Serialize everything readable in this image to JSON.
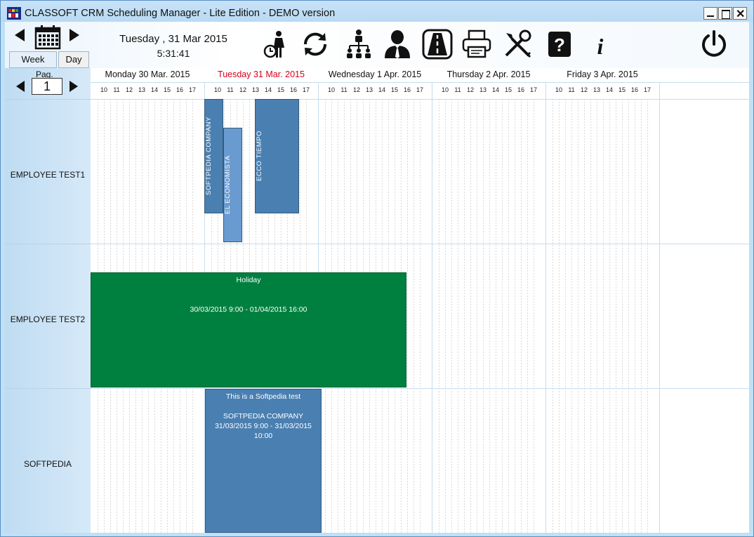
{
  "window": {
    "title": "CLASSOFT CRM Scheduling Manager  - Lite Edition  - DEMO version"
  },
  "toolbar": {
    "date": "Tuesday ,  31 Mar 2015",
    "time": "5:31:41",
    "tools": [
      "clock-person-icon",
      "refresh-icon",
      "org-chart-icon",
      "user-icon",
      "road-icon",
      "printer-icon",
      "tools-icon",
      "help-icon",
      "info-icon",
      "power-icon"
    ]
  },
  "view_tabs": {
    "week": "Week",
    "day": "Day"
  },
  "pager": {
    "label": "Pag.",
    "value": "1"
  },
  "days": [
    {
      "label": "Monday 30 Mar. 2015",
      "today": false
    },
    {
      "label": "Tuesday 31 Mar. 2015",
      "today": true
    },
    {
      "label": "Wednesday 1 Apr. 2015",
      "today": false
    },
    {
      "label": "Thursday 2 Apr. 2015",
      "today": false
    },
    {
      "label": "Friday 3 Apr. 2015",
      "today": false
    }
  ],
  "hours": [
    "10",
    "11",
    "12",
    "13",
    "14",
    "15",
    "16",
    "17"
  ],
  "rows": [
    "EMPLOYEE TEST1",
    "EMPLOYEE TEST2",
    "SOFTPEDIA"
  ],
  "events": {
    "softpedia_company": "SOFTPEDIA COMPANY",
    "el_economista": "EL ECONOMISTA",
    "ecco_tiempo": "ECCO TIEMPO",
    "holiday_title": "Holiday",
    "holiday_range": "30/03/2015 9:00 - 01/04/2015 16:00",
    "test_title": "This is a Softpedia test",
    "test_company": "SOFTPEDIA COMPANY",
    "test_range": "31/03/2015 9:00 - 31/03/2015 10:00"
  },
  "colors": {
    "today": "#d6001c",
    "event_blue": "#4a7fb1",
    "event_light_blue": "#6a9bd0",
    "holiday_green": "#00803f"
  }
}
